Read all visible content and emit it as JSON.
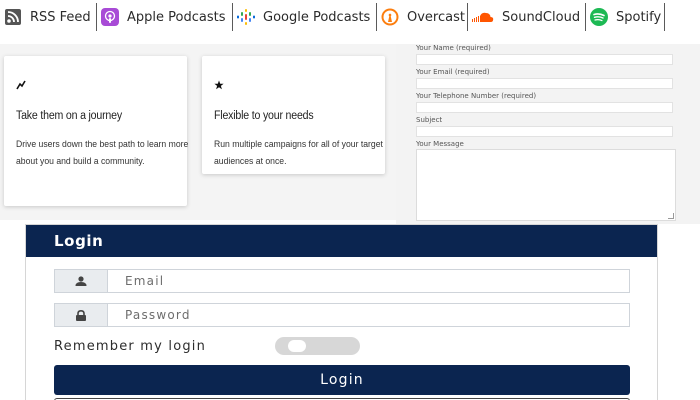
{
  "podcasts": [
    {
      "label": "RSS Feed",
      "icon": "rss-icon",
      "color": "#6b6b6b"
    },
    {
      "label": "Apple Podcasts",
      "icon": "apple-podcasts-icon",
      "color": "#a84bd6"
    },
    {
      "label": "Google Podcasts",
      "icon": "google-podcasts-icon",
      "color": "#4285f4"
    },
    {
      "label": "Overcast",
      "icon": "overcast-icon",
      "color": "#fc7e0f"
    },
    {
      "label": "SoundCloud",
      "icon": "soundcloud-icon",
      "color": "#ff5500"
    },
    {
      "label": "Spotify",
      "icon": "spotify-icon",
      "color": "#1db954"
    }
  ],
  "features": [
    {
      "icon": "route-icon",
      "title": "Take them on a journey",
      "desc": "Drive users down the best path to learn more about you and build a community."
    },
    {
      "icon": "star-icon",
      "title": "Flexible to your needs",
      "desc": "Run multiple campaigns for all of your target audiences at once."
    }
  ],
  "contact_form": {
    "name_label": "Your Name (required)",
    "email_label": "Your Email (required)",
    "phone_label": "Your Telephone Number (required)",
    "subject_label": "Subject",
    "message_label": "Your Message"
  },
  "login": {
    "title": "Login",
    "email_placeholder": "Email",
    "password_placeholder": "Password",
    "remember_label": "Remember my login",
    "remember_on": false,
    "button_label": "Login",
    "accent": "#0b2550"
  }
}
